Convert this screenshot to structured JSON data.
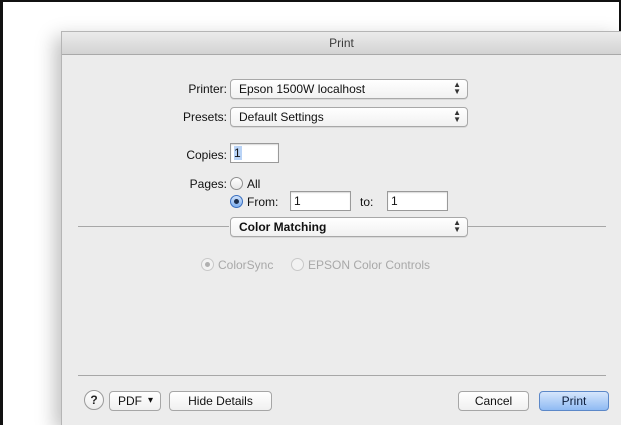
{
  "dialog": {
    "title": "Print"
  },
  "printer": {
    "label": "Printer:",
    "value": "Epson 1500W localhost"
  },
  "presets": {
    "label": "Presets:",
    "value": "Default Settings"
  },
  "copies": {
    "label": "Copies:",
    "value": "1"
  },
  "pages": {
    "label": "Pages:",
    "all_label": "All",
    "from_label": "From:",
    "from_value": "1",
    "to_label": "to:",
    "to_value": "1",
    "selected": "from"
  },
  "section_popup": {
    "value": "Color Matching"
  },
  "color_matching": {
    "options": [
      "ColorSync",
      "EPSON Color Controls"
    ],
    "selected": "ColorSync",
    "enabled": false
  },
  "footer": {
    "help_label": "?",
    "pdf_label": "PDF",
    "pdf_arrow": "▾",
    "hide_details_label": "Hide Details",
    "cancel_label": "Cancel",
    "print_label": "Print"
  },
  "icons": {
    "popup_arrows": "up-down-arrows-icon",
    "dropdown": "chevron-down-icon"
  }
}
